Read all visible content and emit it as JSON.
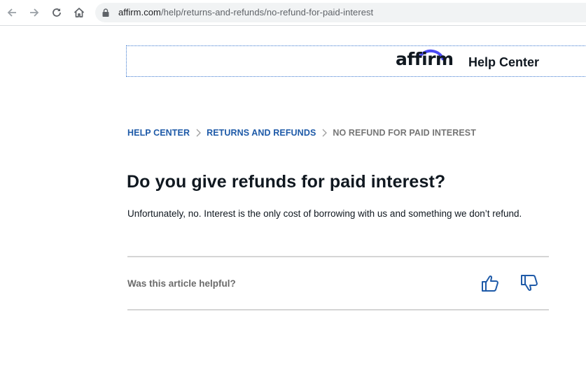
{
  "browser": {
    "url_host": "affirm.com",
    "url_path": "/help/returns-and-refunds/no-refund-for-paid-interest",
    "icons": {
      "back": "arrow-left-icon",
      "forward": "arrow-right-icon",
      "reload": "reload-icon",
      "home": "home-icon",
      "lock": "lock-icon"
    }
  },
  "header": {
    "logo_text": "affirm",
    "title": "Help Center"
  },
  "breadcrumb": {
    "items": [
      {
        "label": "HELP CENTER"
      },
      {
        "label": "RETURNS AND REFUNDS"
      },
      {
        "label": "NO REFUND FOR PAID INTEREST"
      }
    ]
  },
  "article": {
    "title": "Do you give refunds for paid interest?",
    "body": "Unfortunately, no. Interest is the only cost of borrowing with us and something we don’t refund."
  },
  "feedback": {
    "question": "Was this article helpful?",
    "icons": {
      "yes": "thumbs-up-icon",
      "no": "thumbs-down-icon"
    }
  },
  "colors": {
    "link_blue": "#1e5aa8",
    "text_dark": "#101820",
    "icon_blue": "#1e5aa8",
    "logo_arc": "#4a4af4"
  }
}
